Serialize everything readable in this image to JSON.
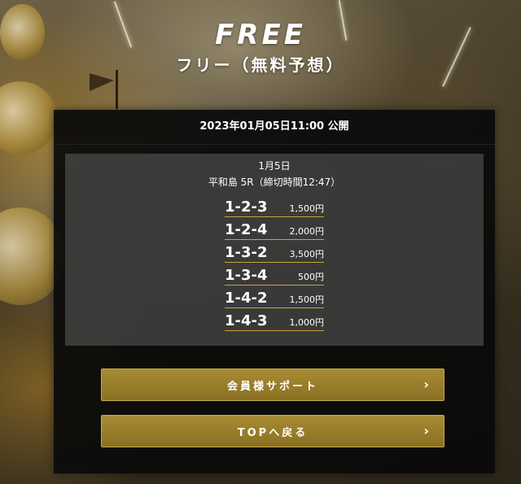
{
  "header": {
    "logo": "FREE",
    "subtitle": "フリー（無料予想）"
  },
  "publish": {
    "text": "2023年01月05日11:00 公開"
  },
  "race": {
    "date": "1月5日",
    "info": "平和島 5R（締切時間12:47）"
  },
  "bets": [
    {
      "combo": "1-2-3",
      "amount": "1,500円"
    },
    {
      "combo": "1-2-4",
      "amount": "2,000円"
    },
    {
      "combo": "1-3-2",
      "amount": "3,500円"
    },
    {
      "combo": "1-3-4",
      "amount": "500円"
    },
    {
      "combo": "1-4-2",
      "amount": "1,500円"
    },
    {
      "combo": "1-4-3",
      "amount": "1,000円"
    }
  ],
  "buttons": {
    "support": "会員様サポート",
    "top": "TOPへ戻る",
    "arrow_icon": "chevron-right-icon"
  },
  "colors": {
    "accent_gold": "#a88b32",
    "underline_gold": "#c9a33a",
    "panel_bg": "#0a0a0a"
  }
}
